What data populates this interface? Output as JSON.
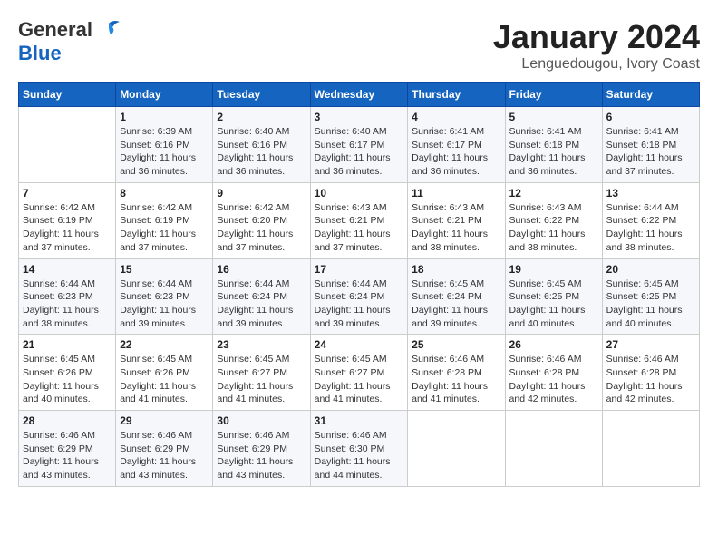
{
  "header": {
    "logo_line1": "General",
    "logo_line2": "Blue",
    "title": "January 2024",
    "subtitle": "Lenguedougou, Ivory Coast"
  },
  "weekdays": [
    "Sunday",
    "Monday",
    "Tuesday",
    "Wednesday",
    "Thursday",
    "Friday",
    "Saturday"
  ],
  "weeks": [
    [
      {
        "num": "",
        "info": ""
      },
      {
        "num": "1",
        "info": "Sunrise: 6:39 AM\nSunset: 6:16 PM\nDaylight: 11 hours\nand 36 minutes."
      },
      {
        "num": "2",
        "info": "Sunrise: 6:40 AM\nSunset: 6:16 PM\nDaylight: 11 hours\nand 36 minutes."
      },
      {
        "num": "3",
        "info": "Sunrise: 6:40 AM\nSunset: 6:17 PM\nDaylight: 11 hours\nand 36 minutes."
      },
      {
        "num": "4",
        "info": "Sunrise: 6:41 AM\nSunset: 6:17 PM\nDaylight: 11 hours\nand 36 minutes."
      },
      {
        "num": "5",
        "info": "Sunrise: 6:41 AM\nSunset: 6:18 PM\nDaylight: 11 hours\nand 36 minutes."
      },
      {
        "num": "6",
        "info": "Sunrise: 6:41 AM\nSunset: 6:18 PM\nDaylight: 11 hours\nand 37 minutes."
      }
    ],
    [
      {
        "num": "7",
        "info": "Sunrise: 6:42 AM\nSunset: 6:19 PM\nDaylight: 11 hours\nand 37 minutes."
      },
      {
        "num": "8",
        "info": "Sunrise: 6:42 AM\nSunset: 6:19 PM\nDaylight: 11 hours\nand 37 minutes."
      },
      {
        "num": "9",
        "info": "Sunrise: 6:42 AM\nSunset: 6:20 PM\nDaylight: 11 hours\nand 37 minutes."
      },
      {
        "num": "10",
        "info": "Sunrise: 6:43 AM\nSunset: 6:21 PM\nDaylight: 11 hours\nand 37 minutes."
      },
      {
        "num": "11",
        "info": "Sunrise: 6:43 AM\nSunset: 6:21 PM\nDaylight: 11 hours\nand 38 minutes."
      },
      {
        "num": "12",
        "info": "Sunrise: 6:43 AM\nSunset: 6:22 PM\nDaylight: 11 hours\nand 38 minutes."
      },
      {
        "num": "13",
        "info": "Sunrise: 6:44 AM\nSunset: 6:22 PM\nDaylight: 11 hours\nand 38 minutes."
      }
    ],
    [
      {
        "num": "14",
        "info": "Sunrise: 6:44 AM\nSunset: 6:23 PM\nDaylight: 11 hours\nand 38 minutes."
      },
      {
        "num": "15",
        "info": "Sunrise: 6:44 AM\nSunset: 6:23 PM\nDaylight: 11 hours\nand 39 minutes."
      },
      {
        "num": "16",
        "info": "Sunrise: 6:44 AM\nSunset: 6:24 PM\nDaylight: 11 hours\nand 39 minutes."
      },
      {
        "num": "17",
        "info": "Sunrise: 6:44 AM\nSunset: 6:24 PM\nDaylight: 11 hours\nand 39 minutes."
      },
      {
        "num": "18",
        "info": "Sunrise: 6:45 AM\nSunset: 6:24 PM\nDaylight: 11 hours\nand 39 minutes."
      },
      {
        "num": "19",
        "info": "Sunrise: 6:45 AM\nSunset: 6:25 PM\nDaylight: 11 hours\nand 40 minutes."
      },
      {
        "num": "20",
        "info": "Sunrise: 6:45 AM\nSunset: 6:25 PM\nDaylight: 11 hours\nand 40 minutes."
      }
    ],
    [
      {
        "num": "21",
        "info": "Sunrise: 6:45 AM\nSunset: 6:26 PM\nDaylight: 11 hours\nand 40 minutes."
      },
      {
        "num": "22",
        "info": "Sunrise: 6:45 AM\nSunset: 6:26 PM\nDaylight: 11 hours\nand 41 minutes."
      },
      {
        "num": "23",
        "info": "Sunrise: 6:45 AM\nSunset: 6:27 PM\nDaylight: 11 hours\nand 41 minutes."
      },
      {
        "num": "24",
        "info": "Sunrise: 6:45 AM\nSunset: 6:27 PM\nDaylight: 11 hours\nand 41 minutes."
      },
      {
        "num": "25",
        "info": "Sunrise: 6:46 AM\nSunset: 6:28 PM\nDaylight: 11 hours\nand 41 minutes."
      },
      {
        "num": "26",
        "info": "Sunrise: 6:46 AM\nSunset: 6:28 PM\nDaylight: 11 hours\nand 42 minutes."
      },
      {
        "num": "27",
        "info": "Sunrise: 6:46 AM\nSunset: 6:28 PM\nDaylight: 11 hours\nand 42 minutes."
      }
    ],
    [
      {
        "num": "28",
        "info": "Sunrise: 6:46 AM\nSunset: 6:29 PM\nDaylight: 11 hours\nand 43 minutes."
      },
      {
        "num": "29",
        "info": "Sunrise: 6:46 AM\nSunset: 6:29 PM\nDaylight: 11 hours\nand 43 minutes."
      },
      {
        "num": "30",
        "info": "Sunrise: 6:46 AM\nSunset: 6:29 PM\nDaylight: 11 hours\nand 43 minutes."
      },
      {
        "num": "31",
        "info": "Sunrise: 6:46 AM\nSunset: 6:30 PM\nDaylight: 11 hours\nand 44 minutes."
      },
      {
        "num": "",
        "info": ""
      },
      {
        "num": "",
        "info": ""
      },
      {
        "num": "",
        "info": ""
      }
    ]
  ]
}
